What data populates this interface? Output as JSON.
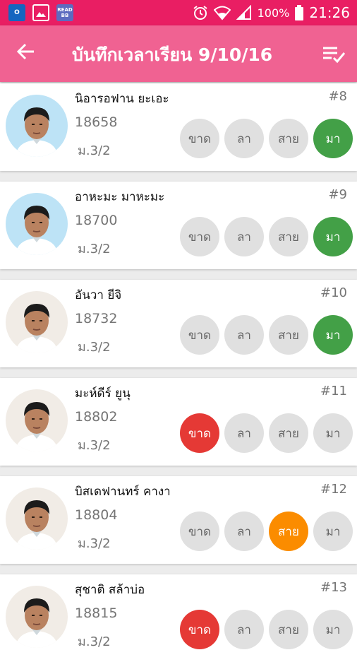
{
  "status_bar": {
    "left_icons": [
      {
        "name": "outlook-icon",
        "label": "O",
        "color": "#1565c0"
      },
      {
        "name": "gallery-icon",
        "label": "",
        "color": "#ffffff"
      },
      {
        "name": "readbb-icon",
        "label": "READ BB",
        "color": "#5c6bc0"
      }
    ],
    "battery": "100%",
    "time": "21:26"
  },
  "app_bar": {
    "title": "บันทึกเวลาเรียน 9/10/16",
    "back_icon": "arrow-left-icon",
    "menu_icon": "playlist-check-icon"
  },
  "status_labels": {
    "absent": "ขาด",
    "leave": "ลา",
    "late": "สาย",
    "present": "มา"
  },
  "colors": {
    "statusbar": "#e91e63",
    "appbar": "#f06292",
    "absent": "#e53935",
    "late": "#fb8c00",
    "present": "#43a047",
    "inactive": "#e0e0e0"
  },
  "students": [
    {
      "name": "นิอารอฟาน ยะเอะ",
      "id": "18658",
      "class": "ม.3/2",
      "number": "#8",
      "status": "present"
    },
    {
      "name": "อาหะมะ มาหะมะ",
      "id": "18700",
      "class": "ม.3/2",
      "number": "#9",
      "status": "present"
    },
    {
      "name": "อันวา ยีจิ",
      "id": "18732",
      "class": "ม.3/2",
      "number": "#10",
      "status": "present"
    },
    {
      "name": "มะห์ดีร์ ยูนุ",
      "id": "18802",
      "class": "ม.3/2",
      "number": "#11",
      "status": "absent"
    },
    {
      "name": "บิสเดฟานทร์ คางา",
      "id": "18804",
      "class": "ม.3/2",
      "number": "#12",
      "status": "late"
    },
    {
      "name": "สุชาติ สล้าบ่อ",
      "id": "18815",
      "class": "ม.3/2",
      "number": "#13",
      "status": "absent"
    }
  ]
}
